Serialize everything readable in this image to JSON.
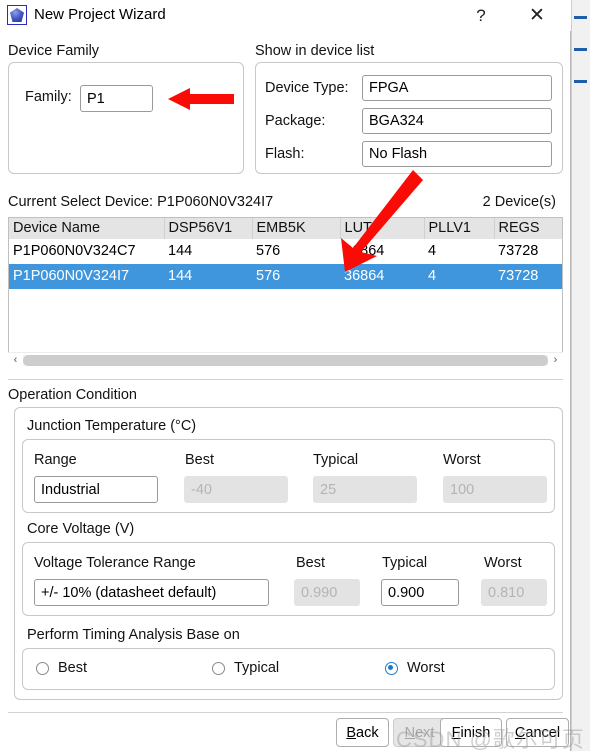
{
  "window": {
    "title": "New Project Wizard",
    "icon": "gem-icon",
    "help_label": "?",
    "close_label": "✕"
  },
  "device_family": {
    "section_label": "Device Family",
    "family_label": "Family:",
    "family_value": "P1"
  },
  "show_in_device_list": {
    "section_label": "Show in device list",
    "rows": [
      {
        "label": "Device Type:",
        "value": "FPGA"
      },
      {
        "label": "Package:",
        "value": "BGA324"
      },
      {
        "label": "Flash:",
        "value": "No Flash"
      }
    ]
  },
  "device_list": {
    "current_select_device": "Current Select Device: P1P060N0V324I7",
    "device_count": "2 Device(s)",
    "columns": [
      "Device Name",
      "DSP56V1",
      "EMB5K",
      "LUT6",
      "PLLV1",
      "REGS"
    ],
    "rows": [
      {
        "cells": [
          "P1P060N0V324C7",
          "144",
          "576",
          "36864",
          "4",
          "73728"
        ],
        "selected": false
      },
      {
        "cells": [
          "P1P060N0V324I7",
          "144",
          "576",
          "36864",
          "4",
          "73728"
        ],
        "selected": true
      }
    ],
    "scroll_left_icon": "‹",
    "scroll_right_icon": "›"
  },
  "operation_condition": {
    "section_label": "Operation Condition",
    "junction_temperature": {
      "group_label": "Junction Temperature (°C)",
      "range_label": "Range",
      "best_label": "Best",
      "typical_label": "Typical",
      "worst_label": "Worst",
      "range_value": "Industrial",
      "best_value": "-40",
      "typical_value": "25",
      "worst_value": "100"
    },
    "core_voltage": {
      "group_label": "Core Voltage (V)",
      "tolerance_label": "Voltage Tolerance Range",
      "best_label": "Best",
      "typical_label": "Typical",
      "worst_label": "Worst",
      "tolerance_value": "+/- 10% (datasheet default)",
      "best_value": "0.990",
      "typical_value": "0.900",
      "worst_value": "0.810"
    },
    "timing_analysis": {
      "group_label": "Perform Timing Analysis Base on",
      "options": [
        {
          "label": "Best",
          "selected": false
        },
        {
          "label": "Typical",
          "selected": false
        },
        {
          "label": "Worst",
          "selected": true
        }
      ]
    }
  },
  "footer": {
    "back_label": "Back",
    "next_label": "Next",
    "finish_label": "Finish",
    "cancel_label": "Cancel"
  },
  "annotations": {
    "arrow_color": "#fb0b06",
    "watermark_text": "CSDN @歌尔可页"
  },
  "colors": {
    "selection_blue": "#3f96dd",
    "header_gray": "#e4e4e4",
    "accent_blue": "#1a7bd4"
  }
}
